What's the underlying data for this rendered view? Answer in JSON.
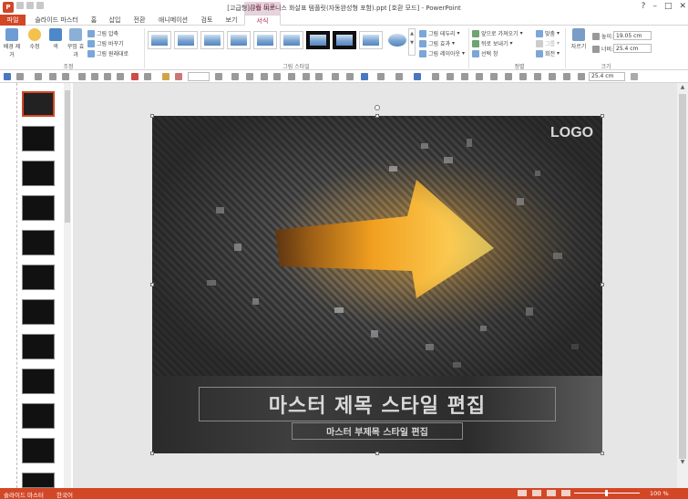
{
  "window": {
    "title": "[고급형]상승 비즈니스 화살표 템플릿(자동완성형 포함).ppt [호환 모드] - PowerPoint",
    "context_tab": "그림 도구",
    "controls": [
      "?",
      "–",
      "□",
      "✕"
    ]
  },
  "tabs": [
    "파일",
    "슬라이드 마스터",
    "홈",
    "삽입",
    "전환",
    "애니메이션",
    "검토",
    "보기",
    "서식"
  ],
  "active_tab": "서식",
  "ribbon": {
    "adjust": {
      "remove_bg": "배경 제거",
      "corrections": "수정",
      "color": "색",
      "artistic": "꾸밈 효과",
      "compress": "그림 압축",
      "change": "그림 바꾸기",
      "reset": "그림 원래대로",
      "label": "조정"
    },
    "styles": {
      "label": "그림 스타일",
      "border": "그림 테두리",
      "effects": "그림 효과",
      "layout": "그림 레이아웃"
    },
    "arrange": {
      "label": "정렬",
      "forward": "앞으로 가져오기",
      "backward": "뒤로 보내기",
      "selection": "선택 창",
      "align": "맞춤",
      "group": "그룹",
      "rotate": "회전"
    },
    "size": {
      "label": "크기",
      "crop": "자르기",
      "height_label": "높이:",
      "height": "19.05 cm",
      "width_label": "너비:",
      "width": "25.4 cm"
    }
  },
  "toolbar2": {
    "size_field": "25.4 cm"
  },
  "slide": {
    "logo": "LOGO",
    "title": "마스터 제목 스타일 편집",
    "subtitle": "마스터 부제목 스타일 편집"
  },
  "thumbnails": [
    "",
    "",
    "",
    "",
    "",
    "",
    "",
    "",
    "",
    "",
    "",
    "",
    ""
  ],
  "status": {
    "view": "슬라이드 마스터",
    "language": "한국어",
    "zoom": "100 %"
  }
}
